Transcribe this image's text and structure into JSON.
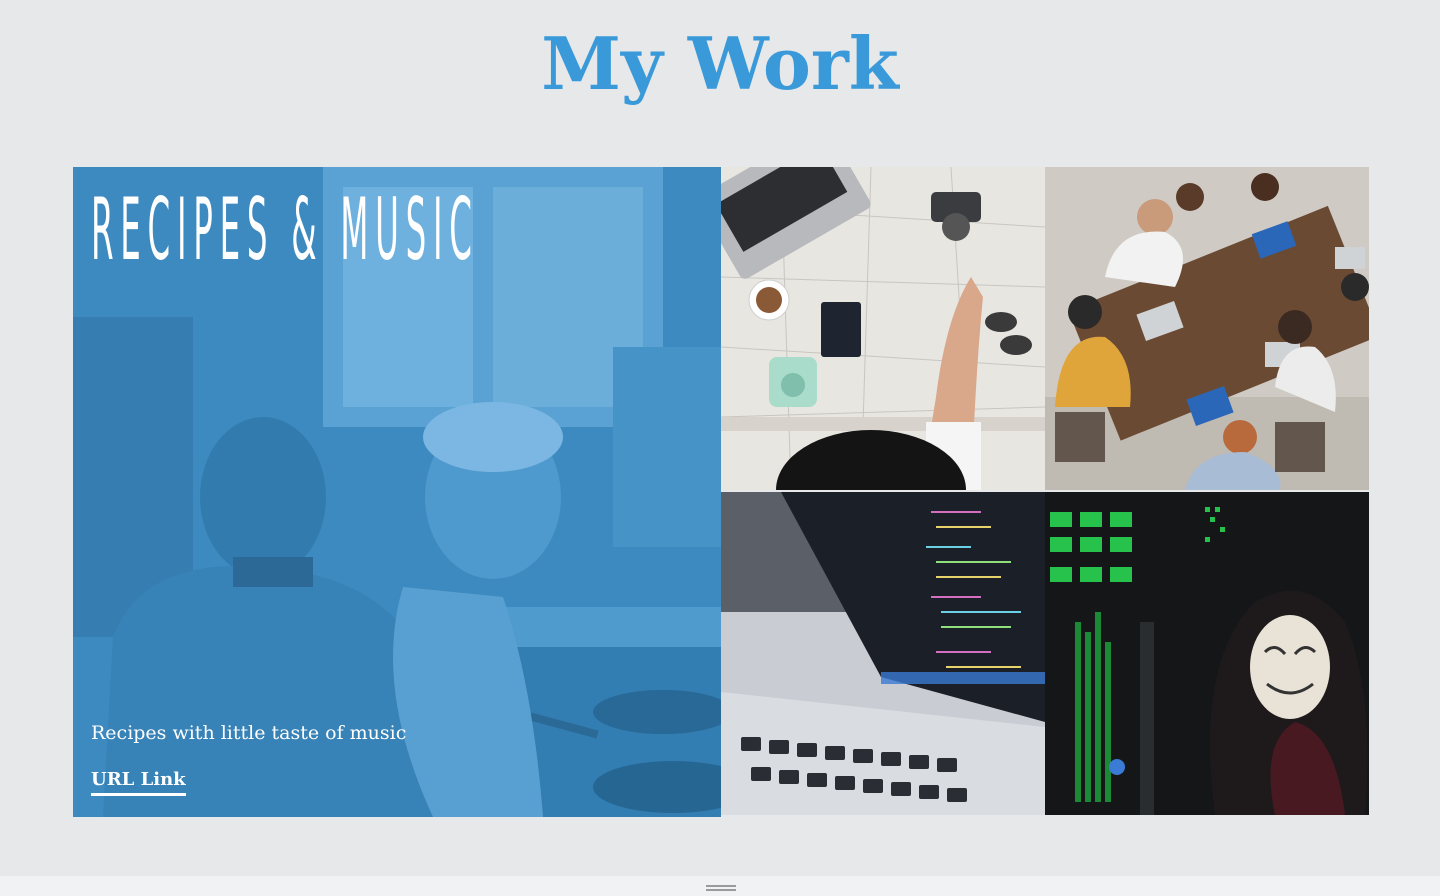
{
  "page": {
    "title": "My Work"
  },
  "featured_project": {
    "heading": "RECIPES & MUSIC",
    "description": "Recipes with little taste of music",
    "link_label": "URL Link",
    "image_subject": "couple-cooking-photo"
  },
  "project_tiles": [
    {
      "image_subject": "travel-map-laptop-photo"
    },
    {
      "image_subject": "team-meeting-photo"
    },
    {
      "image_subject": "laptop-code-photo"
    },
    {
      "image_subject": "hacker-mask-photo"
    }
  ],
  "colors": {
    "background": "#e6e8ea",
    "accent": "#3a9ad9",
    "overlay": "#3a9ad9"
  }
}
